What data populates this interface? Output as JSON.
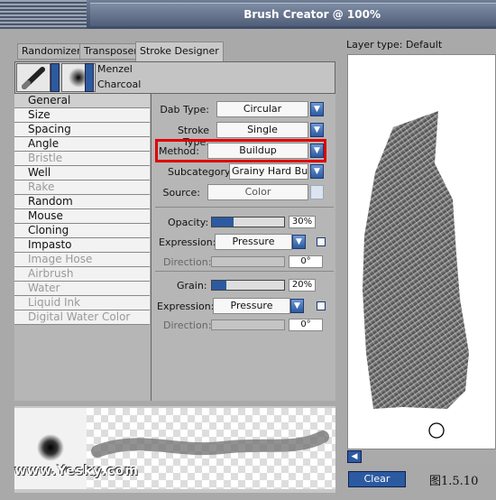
{
  "window": {
    "title": "Brush Creator @ 100%"
  },
  "tabs": [
    {
      "label": "Randomizer"
    },
    {
      "label": "Transposer"
    },
    {
      "label": "Stroke Designer",
      "active": true
    }
  ],
  "brush": {
    "category": "Menzel",
    "variant": "Charcoal"
  },
  "categories": [
    {
      "label": "General",
      "enabled": true,
      "selected": true
    },
    {
      "label": "Size",
      "enabled": true
    },
    {
      "label": "Spacing",
      "enabled": true
    },
    {
      "label": "Angle",
      "enabled": true
    },
    {
      "label": "Bristle",
      "enabled": false
    },
    {
      "label": "Well",
      "enabled": true
    },
    {
      "label": "Rake",
      "enabled": false
    },
    {
      "label": "Random",
      "enabled": true
    },
    {
      "label": "Mouse",
      "enabled": true
    },
    {
      "label": "Cloning",
      "enabled": true
    },
    {
      "label": "Impasto",
      "enabled": true
    },
    {
      "label": "Image Hose",
      "enabled": false
    },
    {
      "label": "Airbrush",
      "enabled": false
    },
    {
      "label": "Water",
      "enabled": false
    },
    {
      "label": "Liquid Ink",
      "enabled": false
    },
    {
      "label": "Digital Water Color",
      "enabled": false
    }
  ],
  "general": {
    "dab_type_label": "Dab Type:",
    "dab_type": "Circular",
    "stroke_type_label": "Stroke Type:",
    "stroke_type": "Single",
    "method_label": "Method:",
    "method": "Buildup",
    "subcategory_label": "Subcategory:",
    "subcategory": "Grainy Hard Bu...",
    "source_label": "Source:",
    "source": "Color",
    "opacity_label": "Opacity:",
    "opacity": "30%",
    "opacity_value": 0.3,
    "opacity_expr_label": "Expression:",
    "opacity_expr": "Pressure",
    "opacity_dir_label": "Direction:",
    "opacity_dir": "0°",
    "grain_label": "Grain:",
    "grain": "20%",
    "grain_value": 0.2,
    "grain_expr_label": "Expression:",
    "grain_expr": "Pressure",
    "grain_dir_label": "Direction:",
    "grain_dir": "0°"
  },
  "canvas": {
    "layer_type": "Layer type: Default"
  },
  "buttons": {
    "clear": "Clear"
  },
  "watermark": "www.Yesky.com",
  "figure_label": "图1.5.10",
  "colors": {
    "accent": "#2c5aa0",
    "highlight": "#e00000"
  }
}
